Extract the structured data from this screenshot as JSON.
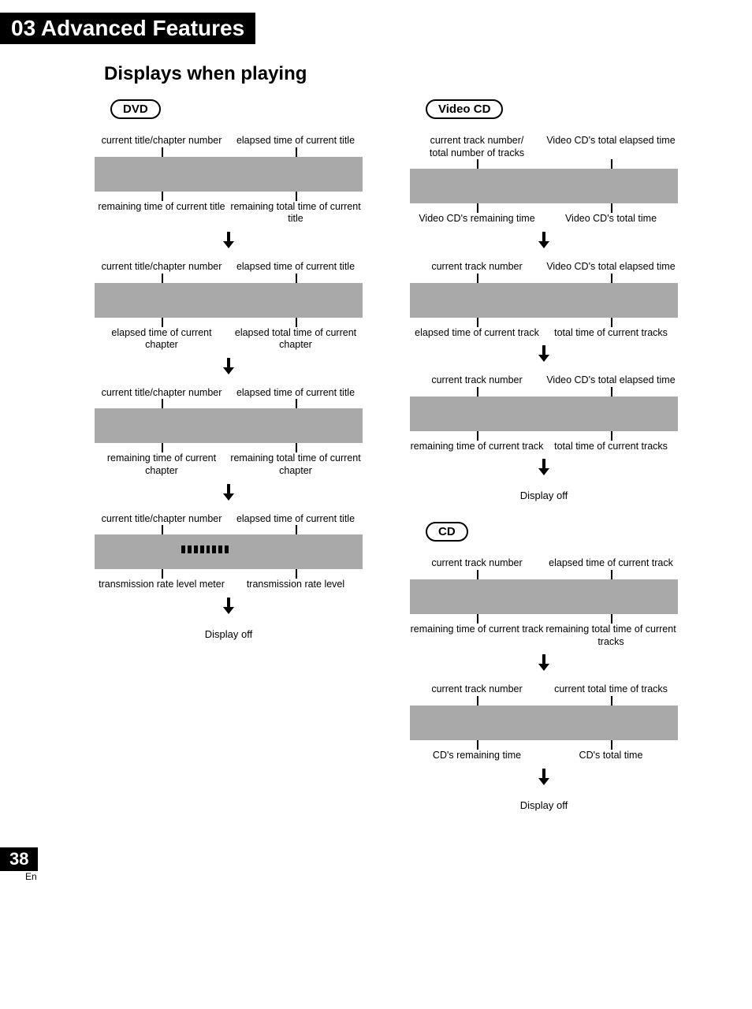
{
  "header": "03 Advanced Features",
  "sectionTitle": "Displays when playing",
  "pageNumber": "38",
  "lang": "En",
  "displayOff": "Display off",
  "dvd": {
    "label": "DVD",
    "blocks": [
      {
        "topLeft": "current title/chapter number",
        "topRight": "elapsed time of current title",
        "bottomLeft": "remaining time of current title",
        "bottomRight": "remaining total time of current title"
      },
      {
        "topLeft": "current title/chapter number",
        "topRight": "elapsed time of current title",
        "bottomLeft": "elapsed time of current chapter",
        "bottomRight": "elapsed total time of current chapter"
      },
      {
        "topLeft": "current title/chapter number",
        "topRight": "elapsed time of current title",
        "bottomLeft": "remaining time of current chapter",
        "bottomRight": "remaining total time of current chapter"
      },
      {
        "topLeft": "current title/chapter number",
        "topRight": "elapsed time of current title",
        "bottomLeft": "transmission rate level meter",
        "bottomRight": "transmission rate level",
        "meter": true
      }
    ]
  },
  "videoCd": {
    "label": "Video CD",
    "blocks": [
      {
        "topLeft": "current track number/\ntotal number of tracks",
        "topRight": "Video CD's total elapsed time",
        "bottomLeft": "Video CD's remaining time",
        "bottomRight": "Video CD's total time"
      },
      {
        "topLeft": "current track number",
        "topRight": "Video CD's total elapsed time",
        "bottomLeft": "elapsed time of current track",
        "bottomRight": "total time of current tracks"
      },
      {
        "topLeft": "current track number",
        "topRight": "Video CD's total elapsed time",
        "bottomLeft": "remaining time of current track",
        "bottomRight": "total time of current tracks"
      }
    ]
  },
  "cd": {
    "label": "CD",
    "blocks": [
      {
        "topLeft": "current track number",
        "topRight": "elapsed time of current track",
        "bottomLeft": "remaining time of current track",
        "bottomRight": "remaining total time of current tracks"
      },
      {
        "topLeft": "current track number",
        "topRight": "current total time of tracks",
        "bottomLeft": "CD's remaining time",
        "bottomRight": "CD's total time"
      }
    ]
  }
}
